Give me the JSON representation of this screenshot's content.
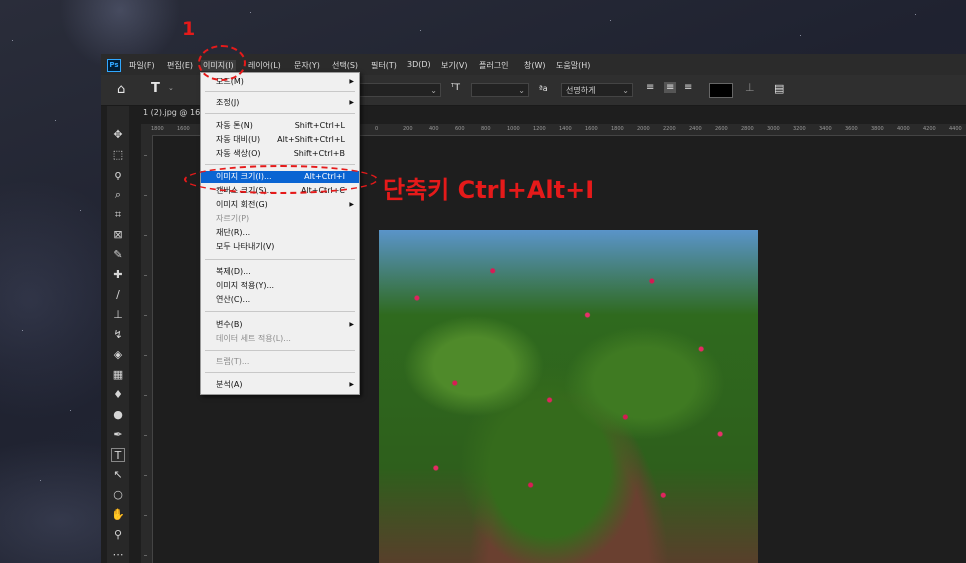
{
  "menubar": {
    "app_icon": "Ps",
    "items": [
      "파일(F)",
      "편집(E)",
      "이미지(I)",
      "레이어(L)",
      "문자(Y)",
      "선택(S)",
      "필터(T)",
      "3D(D)",
      "보기(V)",
      "플러그인",
      "창(W)",
      "도움말(H)"
    ],
    "active_index": 2
  },
  "options": {
    "home_icon": "home-icon",
    "type_tool_label": "T",
    "size_toggle_label": "ᵀT",
    "antialias_prefix": "ªa",
    "antialias_value": "선명하게",
    "color_swatch": "#000000"
  },
  "document": {
    "tab_title": "1 (2).jpg @ 16"
  },
  "ruler": {
    "labels": [
      "1800",
      "1600",
      "0",
      "200",
      "400",
      "600",
      "800",
      "1000",
      "1200",
      "1400",
      "1600",
      "1800",
      "2000",
      "2200",
      "2400",
      "2600",
      "2800",
      "3000",
      "3200",
      "3400",
      "3600",
      "3800",
      "4000",
      "4200",
      "4400"
    ]
  },
  "image_menu": {
    "items": [
      {
        "label": "모드(M)",
        "shortcut": "",
        "submenu": true,
        "disabled": false
      },
      {
        "label": "조정(J)",
        "shortcut": "",
        "submenu": true,
        "disabled": false
      },
      {
        "label": "자동 톤(N)",
        "shortcut": "Shift+Ctrl+L",
        "submenu": false,
        "disabled": false
      },
      {
        "label": "자동 대비(U)",
        "shortcut": "Alt+Shift+Ctrl+L",
        "submenu": false,
        "disabled": false
      },
      {
        "label": "자동 색상(O)",
        "shortcut": "Shift+Ctrl+B",
        "submenu": false,
        "disabled": false
      },
      {
        "label": "이미지 크기(I)...",
        "shortcut": "Alt+Ctrl+I",
        "submenu": false,
        "disabled": false,
        "highlighted": true
      },
      {
        "label": "캔버스 크기(S)...",
        "shortcut": "Alt+Ctrl+C",
        "submenu": false,
        "disabled": false
      },
      {
        "label": "이미지 회전(G)",
        "shortcut": "",
        "submenu": true,
        "disabled": false
      },
      {
        "label": "자르기(P)",
        "shortcut": "",
        "submenu": false,
        "disabled": true
      },
      {
        "label": "재단(R)...",
        "shortcut": "",
        "submenu": false,
        "disabled": false
      },
      {
        "label": "모두 나타내기(V)",
        "shortcut": "",
        "submenu": false,
        "disabled": false
      },
      {
        "label": "복제(D)...",
        "shortcut": "",
        "submenu": false,
        "disabled": false
      },
      {
        "label": "이미지 적용(Y)...",
        "shortcut": "",
        "submenu": false,
        "disabled": false
      },
      {
        "label": "연산(C)...",
        "shortcut": "",
        "submenu": false,
        "disabled": false
      },
      {
        "label": "변수(B)",
        "shortcut": "",
        "submenu": true,
        "disabled": false
      },
      {
        "label": "데이터 세트 적용(L)...",
        "shortcut": "",
        "submenu": false,
        "disabled": true
      },
      {
        "label": "트랩(T)...",
        "shortcut": "",
        "submenu": false,
        "disabled": true
      },
      {
        "label": "분석(A)",
        "shortcut": "",
        "submenu": true,
        "disabled": false
      }
    ]
  },
  "annotation": {
    "step_number": "1",
    "shortcut_callout": "단축키 Ctrl+Alt+I",
    "color": "#e51a1a"
  },
  "tools": [
    "move-icon",
    "marquee-icon",
    "lasso-icon",
    "quick-select-icon",
    "crop-icon",
    "frame-icon",
    "eyedropper-icon",
    "healing-icon",
    "brush-icon",
    "stamp-icon",
    "history-brush-icon",
    "eraser-icon",
    "gradient-icon",
    "blur-icon",
    "dodge-icon",
    "pen-icon",
    "type-icon",
    "path-select-icon",
    "ellipse-icon",
    "hand-icon",
    "zoom-icon",
    "more-icon"
  ]
}
